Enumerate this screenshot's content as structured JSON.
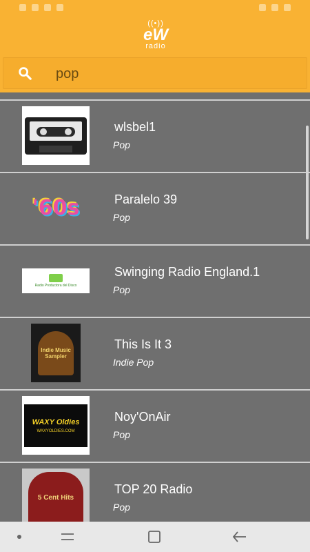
{
  "search": {
    "value": "pop"
  },
  "stations": [
    {
      "title": "wlsbel1",
      "genre": "Pop",
      "thumb": "cassette-tape"
    },
    {
      "title": "Paralelo 39",
      "genre": "Pop",
      "thumb": "60s-logo"
    },
    {
      "title": "Swinging Radio England.1",
      "genre": "Pop",
      "thumb": "radio-logo"
    },
    {
      "title": "This Is It 3",
      "genre": "Indie Pop",
      "thumb": "jukebox-indie"
    },
    {
      "title": "Noy'OnAir",
      "genre": "Pop",
      "thumb": "waxy-oldies"
    },
    {
      "title": "TOP 20 Radio",
      "genre": "Pop",
      "thumb": "jukebox-5cent"
    }
  ],
  "thumb_text": {
    "logo60": "'60s",
    "indie": "Indie Music Sampler",
    "waxy": "WAXY Oldies",
    "waxy_url": "WAXYOLDIES.COM",
    "five_cent": "5 Cent Hits",
    "radio_logo": "Radio Productora del Disco"
  },
  "logo": {
    "brand": "eW",
    "sub": "radio"
  },
  "colors": {
    "accent": "#f9b233",
    "list_bg": "#6f6f6f",
    "divider": "#d0d0d0"
  }
}
